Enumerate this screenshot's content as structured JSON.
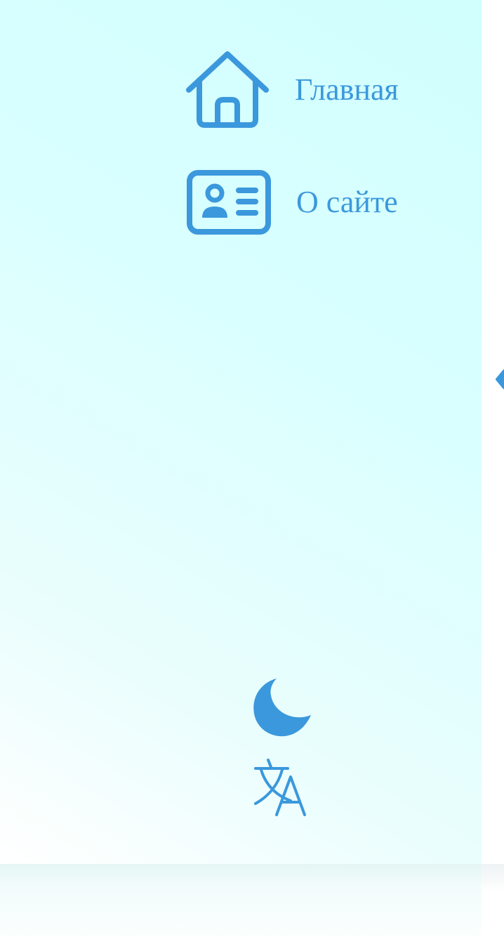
{
  "sidebar": {
    "items": [
      {
        "label": "Главная",
        "icon": "home-icon"
      },
      {
        "label": "О сайте",
        "icon": "id-card-icon"
      }
    ],
    "controls": {
      "theme_icon": "moon-icon",
      "language_icon": "translate-icon"
    }
  },
  "colors": {
    "accent": "#3b98dc",
    "sidebar_bg_start": "#ffffff",
    "sidebar_bg_end": "#d0fffe"
  }
}
